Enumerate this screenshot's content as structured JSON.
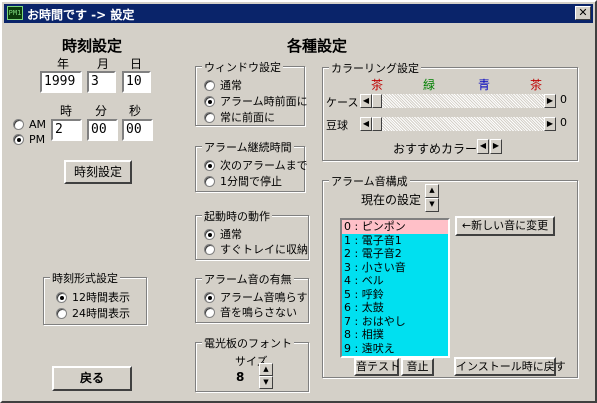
{
  "window": {
    "title": "お時間です -> 設定",
    "icon_text": "PM1",
    "close": "✕"
  },
  "time": {
    "heading": "時刻設定",
    "year_label": "年",
    "month_label": "月",
    "day_label": "日",
    "year": "1999",
    "month": "3",
    "day": "10",
    "hour_label": "時",
    "minute_label": "分",
    "second_label": "秒",
    "am_label": "AM",
    "pm_label": "PM",
    "hour": "2",
    "minute": "00",
    "second": "00",
    "set_button": "時刻設定"
  },
  "format": {
    "title": "時刻形式設定",
    "options": [
      "12時間表示",
      "24時間表示"
    ]
  },
  "back_button": "戻る",
  "settings_heading": "各種設定",
  "window_setting": {
    "title": "ウィンドウ設定",
    "options": [
      "通常",
      "アラーム時前面に",
      "常に前面に"
    ]
  },
  "alarm_duration": {
    "title": "アラーム継続時間",
    "options": [
      "次のアラームまで",
      "1分間で停止"
    ]
  },
  "startup": {
    "title": "起動時の動作",
    "options": [
      "通常",
      "すぐトレイに収納"
    ]
  },
  "alarm_sound": {
    "title": "アラーム音の有無",
    "options": [
      "アラーム音鳴らす",
      "音を鳴らさない"
    ]
  },
  "font": {
    "title": "電光板のフォント",
    "size_label": "サイズ",
    "size": "8"
  },
  "coloring": {
    "title": "カラーリング設定",
    "headers": [
      "茶",
      "緑",
      "青",
      "茶"
    ],
    "header_colors": [
      "#c00000",
      "#008000",
      "#0000c0",
      "#c00000"
    ],
    "case_label": "ケース",
    "case_value": "0",
    "bulb_label": "豆球",
    "bulb_value": "0",
    "recommend_label": "おすすめカラー"
  },
  "alarm_config": {
    "title": "アラーム音構成",
    "current_label": "現在の設定",
    "sounds": [
      "0 : ピンポン",
      "1 : 電子音1",
      "2 : 電子音2",
      "3 : 小さい音",
      "4 : ベル",
      "5 : 呼鈴",
      "6 : 太鼓",
      "7 : おはやし",
      "8 : 相撲",
      "9 : 遠吠え"
    ],
    "change_button": "←新しい音に変更",
    "test_button": "音テスト",
    "stop_button": "音止",
    "reset_button": "インストール時に戻す"
  }
}
